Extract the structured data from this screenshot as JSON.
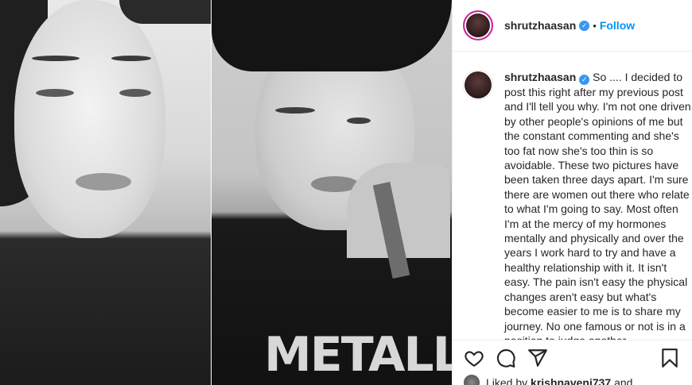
{
  "post": {
    "username": "shrutzhaasan",
    "follow_label": "Follow",
    "separator": "•",
    "verified_glyph": "✓",
    "photos": [
      {
        "name": "photo-left"
      },
      {
        "name": "photo-right",
        "shirt_text": "METALLIC"
      }
    ]
  },
  "caption": {
    "username": "shrutzhaasan",
    "text": "So .... I decided to post this right after my previous post and I'll tell you why. I'm not one driven by other people's opinions of me but the constant commenting and she's too fat now she's too thin is so avoidable. These two pictures have been taken three days apart. I'm sure there are women out there who relate to what I'm going to say. Most often I'm at the mercy of my hormones mentally and physically and over the years I work hard to try and have a healthy relationship with it. It isn't easy. The pain isn't easy the physical changes aren't easy but what's become easier to me is to share my journey. No one famous or not is in a position to judge another"
  },
  "actions": {
    "icons": [
      "heart-icon",
      "comment-icon",
      "share-icon",
      "bookmark-icon"
    ]
  },
  "likes": {
    "prefix": "Liked by",
    "user": "krishnaveni737",
    "suffix": "and"
  },
  "colors": {
    "accent": "#0095f6",
    "verified": "#3897f0",
    "ring": "#d6249f"
  }
}
